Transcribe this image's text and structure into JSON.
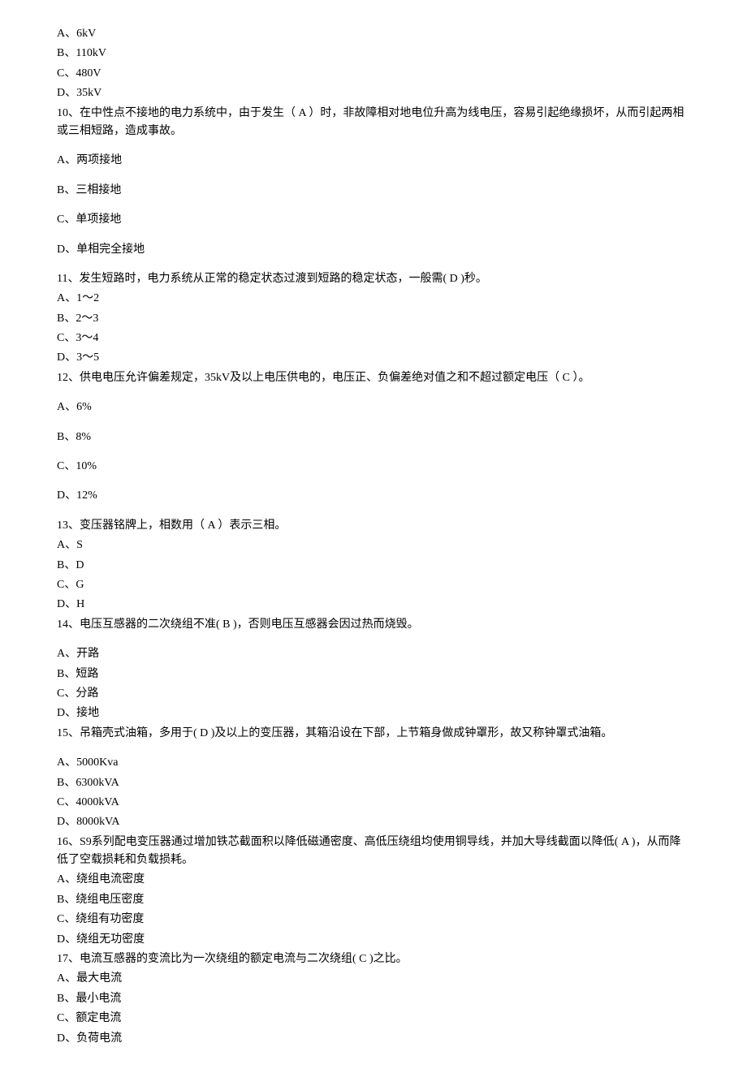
{
  "q9_options": {
    "a": "A、6kV",
    "b": "B、110kV",
    "c": "C、480V",
    "d": "D、35kV"
  },
  "q10": {
    "text": "10、在中性点不接地的电力系统中，由于发生（  A  ）时，非故障相对地电位升高为线电压，容易引起绝缘损坏，从而引起两相或三相短路，造成事故。",
    "a": "A、两项接地",
    "b": "B、三相接地",
    "c": "C、单项接地",
    "d": "D、单相完全接地"
  },
  "q11": {
    "text": "11、发生短路时，电力系统从正常的稳定状态过渡到短路的稳定状态，一般需( D )秒。",
    "a": "A、1～2",
    "b": "B、2～3",
    "c": "C、3～4",
    "d": "D、3～5"
  },
  "q12": {
    "text": "12、供电电压允许偏差规定，35kV及以上电压供电的，电压正、负偏差绝对值之和不超过额定电压（ C  ）。",
    "a": "A、6%",
    "b": "B、8%",
    "c": "C、10%",
    "d": "D、12%"
  },
  "q13": {
    "text": "13、变压器铭牌上，相数用（ A  ）表示三相。",
    "a": "A、S",
    "b": "B、D",
    "c": "C、G",
    "d": "D、H"
  },
  "q14": {
    "text": "14、电压互感器的二次绕组不准(  B )，否则电压互感器会因过热而烧毁。",
    "a": "A、开路",
    "b": "B、短路",
    "c": "C、分路",
    "d": "D、接地"
  },
  "q15": {
    "text": "15、吊箱壳式油箱，多用于(  D )及以上的变压器，其箱沿设在下部，上节箱身做成钟罩形，故又称钟罩式油箱。",
    "a": "A、5000Kva",
    "b": "B、6300kVA",
    "c": "C、4000kVA",
    "d": "D、8000kVA"
  },
  "q16": {
    "text": "16、S9系列配电变压器通过增加铁芯截面积以降低磁通密度、高低压绕组均使用铜导线，并加大导线截面以降低( A  )，从而降低了空载损耗和负载损耗。",
    "a": "A、绕组电流密度",
    "b": "B、绕组电压密度",
    "c": "C、绕组有功密度",
    "d": "D、绕组无功密度"
  },
  "q17": {
    "text": "17、电流互感器的变流比为一次绕组的额定电流与二次绕组( C  )之比。",
    "a": "A、最大电流",
    "b": "B、最小电流",
    "c": "C、额定电流",
    "d": "D、负荷电流"
  }
}
